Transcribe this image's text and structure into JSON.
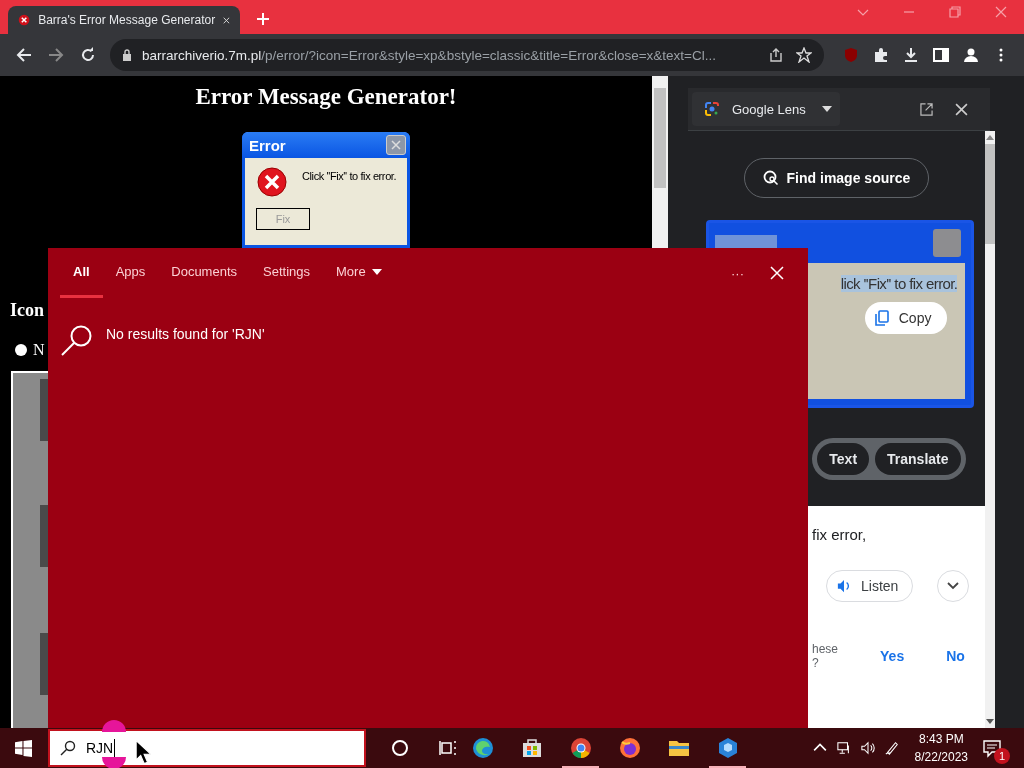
{
  "browser": {
    "tab": {
      "title": "Barra's Error Message Generator",
      "selected": true
    },
    "url": {
      "host": "barrarchiverio.7m.pl",
      "path": "/p/error/?icon=Error&style=xp&bstyle=classic&title=Error&close=x&text=Cl..."
    }
  },
  "page": {
    "heading": "Error Message Generator!",
    "dialog": {
      "title": "Error",
      "message": "Click ''Fix'' to fix error.",
      "button": "Fix"
    },
    "section_heading": "Icon",
    "option": {
      "label": "N",
      "checked": false
    }
  },
  "lens": {
    "title": "Google Lens",
    "find_button": "Find image source",
    "image": {
      "text": "lick ''Fix'' to fix error."
    },
    "copy_button": "Copy",
    "chips": [
      {
        "label": "Text",
        "selected": false
      },
      {
        "label": "Translate",
        "selected": false
      }
    ],
    "result_text": "fix error,",
    "listen_button": "Listen",
    "feedback": {
      "question_line_1": "hese",
      "question_line_2": "?",
      "yes": "Yes",
      "no": "No"
    }
  },
  "search": {
    "tabs": [
      {
        "label": "All",
        "selected": true
      },
      {
        "label": "Apps",
        "selected": false
      },
      {
        "label": "Documents",
        "selected": false
      },
      {
        "label": "Settings",
        "selected": false
      },
      {
        "label": "More",
        "selected": false
      }
    ],
    "more_glyph": "···",
    "message": "No results found for 'RJN'",
    "query": "RJN"
  },
  "taskbar": {
    "apps": [
      {
        "running": false
      },
      {
        "running": false
      },
      {
        "running": true
      },
      {
        "running": false
      },
      {
        "running": false
      },
      {
        "running": true
      }
    ],
    "time": "8:43 PM",
    "date": "8/22/2023",
    "notification_count": "1"
  }
}
